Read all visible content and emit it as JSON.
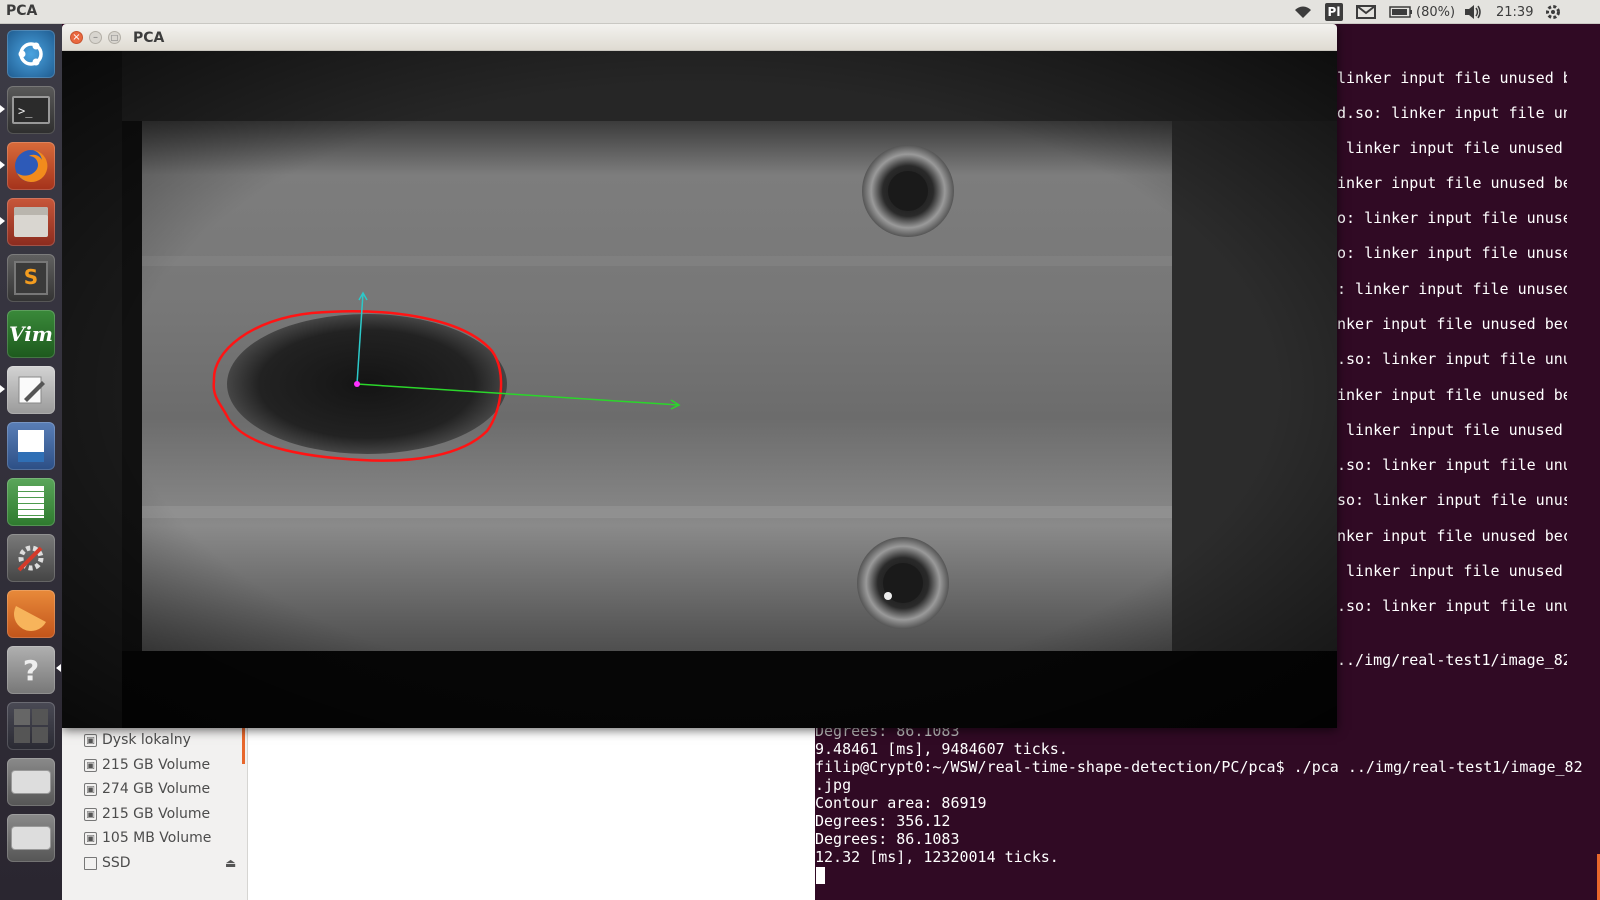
{
  "topbar": {
    "app_name": "PCA",
    "keyboard_layout": "Pl",
    "battery": "(80%)",
    "time": "21:39",
    "icons": [
      "wifi-icon",
      "keyboard-layout-icon",
      "mail-icon",
      "battery-icon",
      "volume-icon",
      "gear-icon"
    ]
  },
  "launcher": {
    "items": [
      "ubuntu-dash",
      "terminal",
      "firefox",
      "files",
      "sublime-text",
      "vim",
      "text-editor",
      "libreoffice-writer",
      "libreoffice-calc",
      "system-settings",
      "orange-app",
      "help",
      "workspace-switcher",
      "drive-1",
      "drive-2"
    ]
  },
  "pca_window": {
    "title": "PCA"
  },
  "terminal": {
    "right_lines": [
      "linker input file unused b",
      "d.so: linker input file un",
      " linker input file unused",
      "inker input file unused be",
      "o: linker input file unuse",
      "o: linker input file unuse",
      ": linker input file unused",
      "nker input file unused bec",
      ".so: linker input file unu",
      "inker input file unused be",
      " linker input file unused",
      ".so: linker input file unu",
      "so: linker input file unus",
      "nker input file unused bec",
      " linker input file unused",
      ".so: linker input file unu"
    ],
    "right_cmd_line": "../img/real-test1/image_82",
    "bottom_lines": [
      "Degrees: 86.1083",
      "9.48461 [ms], 9484607 ticks.",
      "filip@Crypt0:~/WSW/real-time-shape-detection/PC/pca$ ./pca ../img/real-test1/image_82",
      ".jpg",
      "Contour area: 86919",
      "Degrees: 356.12",
      "Degrees: 86.1083",
      "12.32 [ms], 12320014 ticks."
    ]
  },
  "file_manager": {
    "devices": [
      {
        "label": "Dysk lokalny"
      },
      {
        "label": "215 GB Volume"
      },
      {
        "label": "274 GB Volume"
      },
      {
        "label": "215 GB Volume"
      },
      {
        "label": "105 MB Volume"
      },
      {
        "label": "SSD"
      }
    ]
  }
}
